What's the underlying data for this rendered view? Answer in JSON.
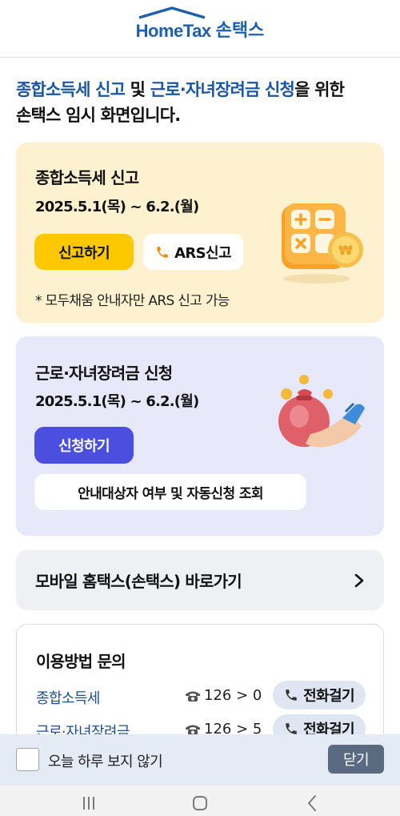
{
  "header": {
    "logo_en": "HomeTax",
    "logo_ko": "손택스"
  },
  "intro": {
    "part1": "종합소득세 신고",
    "part2": " 및 ",
    "part3": "근로·자녀장려금 신청",
    "part4": "을 위한",
    "line2": "손택스 임시 화면입니다."
  },
  "income_tax_card": {
    "title": "종합소득세 신고",
    "date": "2025.5.1(목) ~ 6.2.(월)",
    "report_button": "신고하기",
    "ars_button": "ARS신고",
    "note": "* 모두채움 안내자만 ARS 신고 가능"
  },
  "incentive_card": {
    "title": "근로·자녀장려금 신청",
    "date": "2025.5.1(목) ~ 6.2.(월)",
    "apply_button": "신청하기",
    "lookup_button": "안내대상자 여부 및 자동신청 조회"
  },
  "mobile_link": {
    "label": "모바일 홈택스(손택스) 바로가기"
  },
  "inquiry": {
    "title": "이용방법 문의",
    "rows": [
      {
        "label": "종합소득세",
        "number": "126 > 0",
        "call": "전화걸기"
      },
      {
        "label": "근로·자녀장려금",
        "number": "126 > 5",
        "call": "전화걸기"
      }
    ]
  },
  "bottom_bar": {
    "checkbox_label": "오늘 하루 보지 않기",
    "close_button": "닫기"
  },
  "icons": [
    "phone-icon",
    "chevron-right-icon",
    "telephone-icon",
    "menu-icon",
    "home-icon",
    "back-icon"
  ],
  "colors": {
    "brand": "#1e5fae",
    "yellow_card": "#fdf1cf",
    "purple_card": "#e7e9fb",
    "report_btn": "#fdc800",
    "apply_btn": "#4a4fe0"
  }
}
